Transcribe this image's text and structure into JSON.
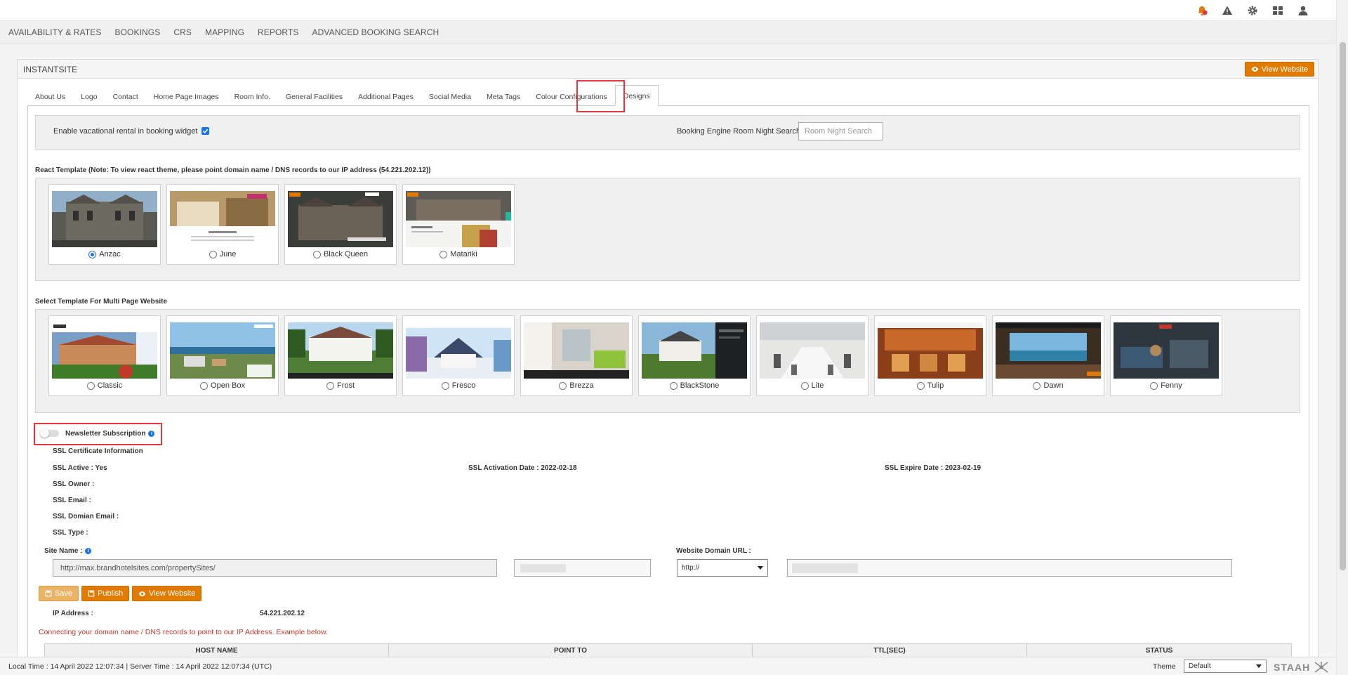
{
  "menu": [
    "AVAILABILITY & RATES",
    "BOOKINGS",
    "CRS",
    "MAPPING",
    "REPORTS",
    "ADVANCED BOOKING SEARCH"
  ],
  "panel": {
    "title": "INSTANTSITE",
    "view_website": "View Website"
  },
  "tabs": [
    "About Us",
    "Logo",
    "Contact",
    "Home Page Images",
    "Room Info.",
    "General Facilities",
    "Additional Pages",
    "Social Media",
    "Meta Tags",
    "Colour Configurations",
    "Designs"
  ],
  "active_tab": "Designs",
  "widget": {
    "vacation_label": "Enable vacational rental in booking widget",
    "vacation_checked": true,
    "room_night_label": "Booking Engine Room Night Search",
    "room_night_placeholder": "Room Night Search"
  },
  "react_section": {
    "title": "React Template (Note: To view react theme, please point domain name / DNS records to our IP address (54.221.202.12))",
    "templates": [
      {
        "name": "Anzac",
        "selected": true
      },
      {
        "name": "June",
        "selected": false
      },
      {
        "name": "Black Queen",
        "selected": false
      },
      {
        "name": "Matariki",
        "selected": false
      }
    ]
  },
  "multi_section": {
    "title": "Select Template For Multi Page Website",
    "templates": [
      {
        "name": "Classic"
      },
      {
        "name": "Open Box"
      },
      {
        "name": "Frost"
      },
      {
        "name": "Fresco"
      },
      {
        "name": "Brezza"
      },
      {
        "name": "BlackStone"
      },
      {
        "name": "Lite"
      },
      {
        "name": "Tulip"
      },
      {
        "name": "Dawn"
      },
      {
        "name": "Fenny"
      }
    ]
  },
  "newsletter": {
    "label": "Newsletter Subscription",
    "enabled": false
  },
  "ssl": {
    "title": "SSL Certificate Information",
    "active": "SSL Active : Yes",
    "activation_date": "SSL Activation Date : 2022-02-18",
    "expire_date": "SSL Expire Date : 2023-02-19",
    "owner": "SSL Owner :",
    "email": "SSL Email :",
    "domain_email": "SSL Domian Email :",
    "type": "SSL Type :"
  },
  "site": {
    "name_label": "Site Name :",
    "name_value": "http://max.brandhotelsites.com/propertySites/",
    "domain_label": "Website Domain URL :",
    "protocol": "http://"
  },
  "buttons": {
    "save": "Save",
    "publish": "Publish",
    "view_website": "View Website"
  },
  "ip": {
    "label": "IP Address :",
    "value": "54.221.202.12"
  },
  "dns_note": "Connecting your domain name / DNS records to point to our IP Address. Example below.",
  "dns_table": {
    "headers": [
      "HOST NAME",
      "POINT TO",
      "TTL(SEC)",
      "STATUS"
    ]
  },
  "footer": {
    "time": "Local Time : 14 April 2022 12:07:34 | Server Time : 14 April 2022 12:07:34 (UTC)",
    "theme_label": "Theme",
    "theme_value": "Default",
    "logo": "STAAH"
  },
  "colors": {
    "accent": "#e07b00",
    "highlight": "#e0393e",
    "checkbox": "#1a73e8"
  },
  "icons": [
    "notification-icon",
    "warning-icon",
    "gear-icon",
    "grid-icon",
    "user-icon"
  ]
}
